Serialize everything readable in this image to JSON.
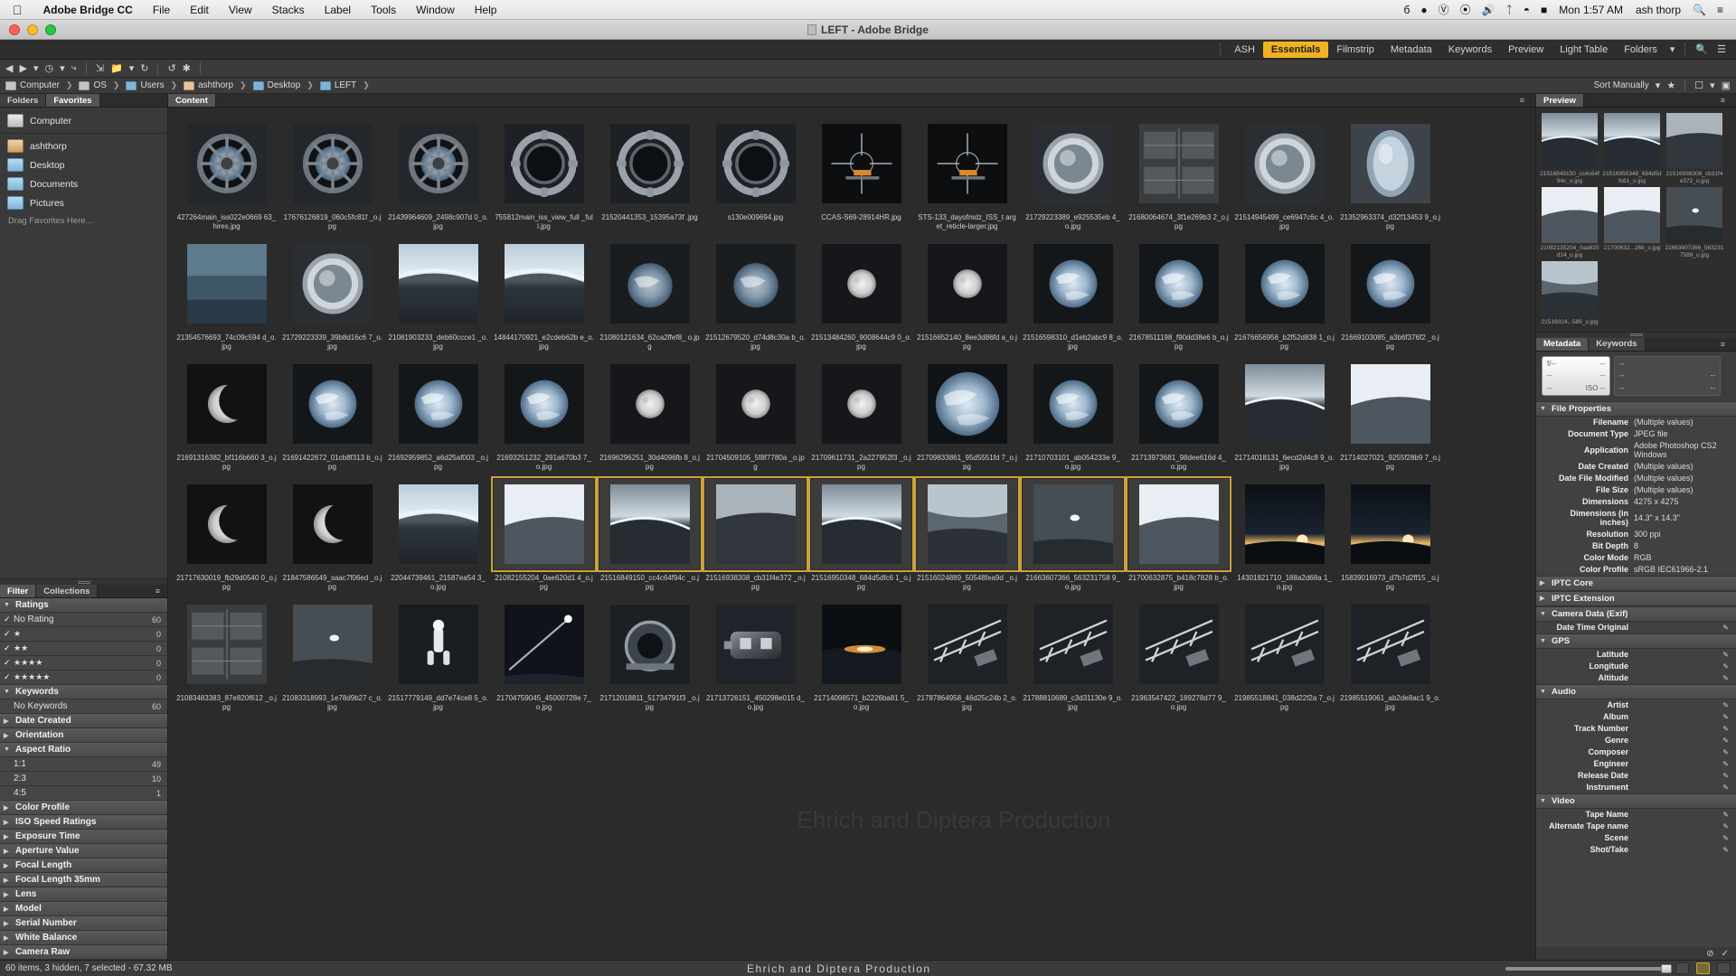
{
  "macbar": {
    "app_name": "Adobe Bridge CC",
    "menus": [
      "File",
      "Edit",
      "View",
      "Stacks",
      "Label",
      "Tools",
      "Window",
      "Help"
    ],
    "status_icons": [
      "b-icon",
      "dropbox-icon",
      "creative-cloud-icon",
      "droplet-icon",
      "bluetooth-icon",
      "wifi-icon",
      "battery-icon",
      "search-icon",
      "control-center-icon"
    ],
    "clock": "Mon 1:57 AM",
    "user": "ash thorp"
  },
  "window": {
    "title": "LEFT - Adobe Bridge"
  },
  "workspace": {
    "tabs": [
      "ASH",
      "Essentials",
      "Filmstrip",
      "Metadata",
      "Keywords",
      "Preview",
      "Light Table",
      "Folders"
    ],
    "active": "Essentials",
    "overflow_icon": "chevron-down-icon",
    "search_placeholder": ""
  },
  "navbar": {
    "back_icon": "back-arrow-icon",
    "forward_icon": "forward-arrow-icon",
    "recent_icon": "recent-folders-icon",
    "boomerang_icon": "boomerang-icon",
    "path_icon": "path-icon",
    "new_folder_icon": "new-folder-icon",
    "rotate_ccw_icon": "rotate-ccw-icon",
    "rotate_cw_icon": "rotate-cw-icon",
    "refine_icon": "refine-icon",
    "breadcrumb": [
      "Computer",
      "OS",
      "Users",
      "ashthorp",
      "Desktop",
      "LEFT"
    ],
    "sort_label": "Sort Manually",
    "filter_icon": "filter-icon",
    "switch_icon": "switch-workspace-icon",
    "compact_icon": "compact-mode-icon"
  },
  "left_panel": {
    "tabs": [
      "Folders",
      "Favorites"
    ],
    "active_tab": "Favorites",
    "favorites": [
      {
        "label": "Computer",
        "icon": "computer-icon"
      },
      {
        "label": "ashthorp",
        "icon": "home-icon"
      },
      {
        "label": "Desktop",
        "icon": "folder-icon"
      },
      {
        "label": "Documents",
        "icon": "folder-icon"
      },
      {
        "label": "Pictures",
        "icon": "folder-icon"
      }
    ],
    "drag_hint": "Drag Favorites Here..."
  },
  "filter_panel": {
    "tabs": [
      "Filter",
      "Collections"
    ],
    "active_tab": "Filter",
    "groups": [
      {
        "label": "Ratings",
        "expanded": true,
        "rows": [
          {
            "label": "No Rating",
            "checked": true,
            "count": "60",
            "stars": ""
          },
          {
            "label": "",
            "checked": true,
            "count": "0",
            "stars": "★"
          },
          {
            "label": "",
            "checked": true,
            "count": "0",
            "stars": "★★"
          },
          {
            "label": "",
            "checked": true,
            "count": "0",
            "stars": "★★★★"
          },
          {
            "label": "",
            "checked": true,
            "count": "0",
            "stars": "★★★★★"
          }
        ]
      },
      {
        "label": "Keywords",
        "expanded": true,
        "rows": [
          {
            "label": "No Keywords",
            "checked": false,
            "count": "60",
            "stars": ""
          }
        ]
      },
      {
        "label": "Date Created",
        "expanded": false,
        "rows": []
      },
      {
        "label": "Orientation",
        "expanded": false,
        "rows": []
      },
      {
        "label": "Aspect Ratio",
        "expanded": true,
        "rows": [
          {
            "label": "1:1",
            "checked": false,
            "count": "49",
            "stars": ""
          },
          {
            "label": "2:3",
            "checked": false,
            "count": "10",
            "stars": ""
          },
          {
            "label": "4:5",
            "checked": false,
            "count": "1",
            "stars": ""
          }
        ]
      },
      {
        "label": "Color Profile",
        "expanded": false,
        "rows": []
      },
      {
        "label": "ISO Speed Ratings",
        "expanded": false,
        "rows": []
      },
      {
        "label": "Exposure Time",
        "expanded": false,
        "rows": []
      },
      {
        "label": "Aperture Value",
        "expanded": false,
        "rows": []
      },
      {
        "label": "Focal Length",
        "expanded": false,
        "rows": []
      },
      {
        "label": "Focal Length 35mm",
        "expanded": false,
        "rows": []
      },
      {
        "label": "Lens",
        "expanded": false,
        "rows": []
      },
      {
        "label": "Model",
        "expanded": false,
        "rows": []
      },
      {
        "label": "Serial Number",
        "expanded": false,
        "rows": []
      },
      {
        "label": "White Balance",
        "expanded": false,
        "rows": []
      },
      {
        "label": "Camera Raw",
        "expanded": false,
        "rows": []
      }
    ]
  },
  "content": {
    "tab_label": "Content",
    "thumbnails": [
      {
        "name": "427264main_iss022e0669\n63_hires.jpg",
        "kind": "cupola",
        "selected": false
      },
      {
        "name": "17676126819_060c5fc81f\n_o.jpg",
        "kind": "cupola",
        "selected": false
      },
      {
        "name": "21439964609_2498c907d\n0_o.jpg",
        "kind": "cupola",
        "selected": false
      },
      {
        "name": "755812main_iss_view_full\n_full.jpg",
        "kind": "hatch",
        "selected": false
      },
      {
        "name": "21520441353_15395a73f\n.jpg",
        "kind": "hatch",
        "selected": false
      },
      {
        "name": "s130e009694.jpg",
        "kind": "hatch",
        "selected": false
      },
      {
        "name": "CCAS-S69-28914HR.jpg",
        "kind": "reticle",
        "selected": false
      },
      {
        "name": "STS-133_dayofmdz_ISS_t\narget_reticle-larger.jpg",
        "kind": "reticle",
        "selected": false
      },
      {
        "name": "21729223389_e925535eb\n4_o.jpg",
        "kind": "porthole",
        "selected": false
      },
      {
        "name": "21680064674_3f1e269b3\n2_o.jpg",
        "kind": "panel",
        "selected": false
      },
      {
        "name": "21514945499_ce6947c6c\n4_o.jpg",
        "kind": "porthole",
        "selected": false
      },
      {
        "name": "21352963374_d32f13453\n9_o.jpg",
        "kind": "window",
        "selected": false
      },
      {
        "name": "21354576693_74c09c594\nd_o.jpg",
        "kind": "blue",
        "selected": false
      },
      {
        "name": "21729223339_39b8d16c6\n7_o.jpg",
        "kind": "porthole",
        "selected": false
      },
      {
        "name": "21081903233_deb60ccce1\n_o.jpg",
        "kind": "earthlimb",
        "selected": false
      },
      {
        "name": "14844170921_e2cdeb62b\ne_o.jpg",
        "kind": "earthlimb",
        "selected": false
      },
      {
        "name": "21080121634_62ca2ffef8_\no.jpg",
        "kind": "earthdark",
        "selected": false
      },
      {
        "name": "21512679520_d74d8c30a\nb_o.jpg",
        "kind": "earthdark",
        "selected": false
      },
      {
        "name": "21513484260_9008644c9\n0_o.jpg",
        "kind": "moon",
        "selected": false
      },
      {
        "name": "21516652140_8ee3d86fd\na_o.jpg",
        "kind": "moon",
        "selected": false
      },
      {
        "name": "21516598310_d1eb2abc9\n8_o.jpg",
        "kind": "earth",
        "selected": false
      },
      {
        "name": "21678511198_f90dd38e6\nb_o.jpg",
        "kind": "earth",
        "selected": false
      },
      {
        "name": "21676656956_b2f52d838\n1_o.jpg",
        "kind": "earth",
        "selected": false
      },
      {
        "name": "21669103085_a3b6f376f2\n_o.jpg",
        "kind": "earth",
        "selected": false
      },
      {
        "name": "21691316382_bf116b660\n3_o.jpg",
        "kind": "crescentmoon",
        "selected": false
      },
      {
        "name": "21691422672_01cb8f313\nb_o.jpg",
        "kind": "earth",
        "selected": false
      },
      {
        "name": "21692959852_a6d25af003\n_o.jpg",
        "kind": "earth",
        "selected": false
      },
      {
        "name": "21693251232_291a670b3\n7_o.jpg",
        "kind": "earth",
        "selected": false
      },
      {
        "name": "21696296251_30d4096fb\n8_o.jpg",
        "kind": "moon",
        "selected": false
      },
      {
        "name": "21704509105_5f8f7780a\n_o.jpg",
        "kind": "moon",
        "selected": false
      },
      {
        "name": "21709611731_2a227952f3\n_o.jpg",
        "kind": "moon",
        "selected": false
      },
      {
        "name": "21709833861_95d5551fd\n7_o.jpg",
        "kind": "earthbig",
        "selected": false
      },
      {
        "name": "21710703101_ab054233e\n9_o.jpg",
        "kind": "earth",
        "selected": false
      },
      {
        "name": "21713973681_98dee616d\n4_o.jpg",
        "kind": "earth",
        "selected": false
      },
      {
        "name": "21714018131_6ecd2d4c8\n9_o.jpg",
        "kind": "limbdark",
        "selected": false
      },
      {
        "name": "21714027021_9255f28b9\n7_o.jpg",
        "kind": "limbwhite",
        "selected": false
      },
      {
        "name": "21717630019_fb29d0540\n0_o.jpg",
        "kind": "crescentmoon",
        "selected": false
      },
      {
        "name": "21847586549_saac7f06ed\n_o.jpg",
        "kind": "crescentmoon",
        "selected": false
      },
      {
        "name": "22044739461_21587ea54\n3_o.jpg",
        "kind": "earthlimb",
        "selected": false
      },
      {
        "name": "21082155204_0ae620d1\n4_o.jpg",
        "kind": "limbwhite",
        "selected": true
      },
      {
        "name": "21516849150_cc4c64f94c\n_o.jpg",
        "kind": "limbdark",
        "selected": true
      },
      {
        "name": "21516938308_cb31f4e372\n_o.jpg",
        "kind": "limbgrey",
        "selected": true
      },
      {
        "name": "21516950348_684d5dfc6\n1_o.jpg",
        "kind": "limbdark",
        "selected": true
      },
      {
        "name": "21516024889_50548fea9d\n_o.jpg",
        "kind": "limbcloud",
        "selected": true
      },
      {
        "name": "21663607366_563231758\n9_o.jpg",
        "kind": "dot",
        "selected": true
      },
      {
        "name": "21700632875_b418c7828\nb_o.jpg",
        "kind": "limbwhite",
        "selected": true
      },
      {
        "name": "14301821710_188a2d68a\n1_o.jpg",
        "kind": "sunrise",
        "selected": false
      },
      {
        "name": "15839016973_d7b7d2ff15\n_o.jpg",
        "kind": "sunrise",
        "selected": false
      },
      {
        "name": "21083483383_87e820f612\n_o.jpg",
        "kind": "panel",
        "selected": false
      },
      {
        "name": "21083318993_1e78d9b27\nc_o.jpg",
        "kind": "dot",
        "selected": false
      },
      {
        "name": "21517779149_dd7e74ce8\n5_o.jpg",
        "kind": "astronaut",
        "selected": false
      },
      {
        "name": "21704759045_45000728e\n7_o.jpg",
        "kind": "comet",
        "selected": false
      },
      {
        "name": "21712018811_51734791f3\n_o.jpg",
        "kind": "dome",
        "selected": false
      },
      {
        "name": "21713726151_450298e015\nd_o.jpg",
        "kind": "module",
        "selected": false
      },
      {
        "name": "21714098571_b2226ba81\n5_o.jpg",
        "kind": "sunset",
        "selected": false
      },
      {
        "name": "21787864958_46d25c24b\n2_o.jpg",
        "kind": "truss",
        "selected": false
      },
      {
        "name": "21788810689_c3d31130e\n9_o.jpg",
        "kind": "truss",
        "selected": false
      },
      {
        "name": "21963547422_189278d77\n9_o.jpg",
        "kind": "truss",
        "selected": false
      },
      {
        "name": "21985518841_038d22f2a\n7_o.jpg",
        "kind": "truss",
        "selected": false
      },
      {
        "name": "21985519061_ab2de8ac1\n9_o.jpg",
        "kind": "truss",
        "selected": false
      }
    ],
    "watermark": "Ehrich and Diptera Production"
  },
  "preview_panel": {
    "tab_label": "Preview",
    "items": [
      {
        "caption": "21516849150_cc4c64f94c_o.jpg",
        "kind": "limbdark"
      },
      {
        "caption": "21516950348_684d5dfc61_o.jpg",
        "kind": "limbdark"
      },
      {
        "caption": "21516938308_cb31f4e372_o.jpg",
        "kind": "limbgrey"
      },
      {
        "caption": "21082135204_0aa620d14_o.jpg",
        "kind": "limbwhite"
      },
      {
        "caption": "21700632...26b_o.jpg",
        "kind": "limbwhite"
      },
      {
        "caption": "21663607366_5632317589_o.jpg",
        "kind": "dot"
      },
      {
        "caption": "21516024...589_o.jpg",
        "kind": "limbcloud"
      }
    ]
  },
  "metadata_panel": {
    "tabs": [
      "Metadata",
      "Keywords"
    ],
    "active_tab": "Metadata",
    "menu_icon": "panel-menu-icon",
    "placeholder_values": [
      "--",
      "--",
      "--",
      "--",
      "ISO --",
      "--",
      "--",
      "--",
      "--"
    ],
    "sections": [
      {
        "label": "File Properties",
        "expanded": true,
        "rows": [
          {
            "label": "Filename",
            "value": "(Multiple values)"
          },
          {
            "label": "Document Type",
            "value": "JPEG file"
          },
          {
            "label": "Application",
            "value": "Adobe Photoshop CS2 Windows"
          },
          {
            "label": "Date Created",
            "value": "(Multiple values)"
          },
          {
            "label": "Date File Modified",
            "value": "(Multiple values)"
          },
          {
            "label": "File Size",
            "value": "(Multiple values)"
          },
          {
            "label": "Dimensions",
            "value": "4275 x 4275"
          },
          {
            "label": "Dimensions (in inches)",
            "value": "14.3\" x 14.3\""
          },
          {
            "label": "Resolution",
            "value": "300 ppi"
          },
          {
            "label": "Bit Depth",
            "value": "8"
          },
          {
            "label": "Color Mode",
            "value": "RGB"
          },
          {
            "label": "Color Profile",
            "value": "sRGB IEC61966-2.1"
          }
        ]
      },
      {
        "label": "IPTC Core",
        "expanded": false,
        "rows": []
      },
      {
        "label": "IPTC Extension",
        "expanded": false,
        "rows": []
      },
      {
        "label": "Camera Data (Exif)",
        "expanded": true,
        "rows": [
          {
            "label": "Date Time Original",
            "value": "",
            "editable": true
          }
        ]
      },
      {
        "label": "GPS",
        "expanded": true,
        "rows": [
          {
            "label": "Latitude",
            "value": "",
            "editable": true
          },
          {
            "label": "Longitude",
            "value": "",
            "editable": true
          },
          {
            "label": "Altitude",
            "value": "",
            "editable": true
          }
        ]
      },
      {
        "label": "Audio",
        "expanded": true,
        "rows": [
          {
            "label": "Artist",
            "value": "",
            "editable": true
          },
          {
            "label": "Album",
            "value": "",
            "editable": true
          },
          {
            "label": "Track Number",
            "value": "",
            "editable": true
          },
          {
            "label": "Genre",
            "value": "",
            "editable": true
          },
          {
            "label": "Composer",
            "value": "",
            "editable": true
          },
          {
            "label": "Engineer",
            "value": "",
            "editable": true
          },
          {
            "label": "Release Date",
            "value": "",
            "editable": true
          },
          {
            "label": "Instrument",
            "value": "",
            "editable": true
          }
        ]
      },
      {
        "label": "Video",
        "expanded": true,
        "rows": [
          {
            "label": "Tape Name",
            "value": "",
            "editable": true
          },
          {
            "label": "Alternate Tape name",
            "value": "",
            "editable": true
          },
          {
            "label": "Scene",
            "value": "",
            "editable": true
          },
          {
            "label": "Shot/Take",
            "value": "",
            "editable": true
          }
        ]
      }
    ],
    "cancel_icon": "cancel-icon",
    "apply_icon": "apply-check-icon"
  },
  "statusbar": {
    "status_text": "60 items, 3 hidden, 7 selected - 67.32 MB",
    "production_text": "Ehrich  and  Diptera  Production",
    "zoom_percent": 100,
    "view_icons": [
      "grid-view-icon",
      "details-view-icon",
      "list-view-icon"
    ]
  }
}
